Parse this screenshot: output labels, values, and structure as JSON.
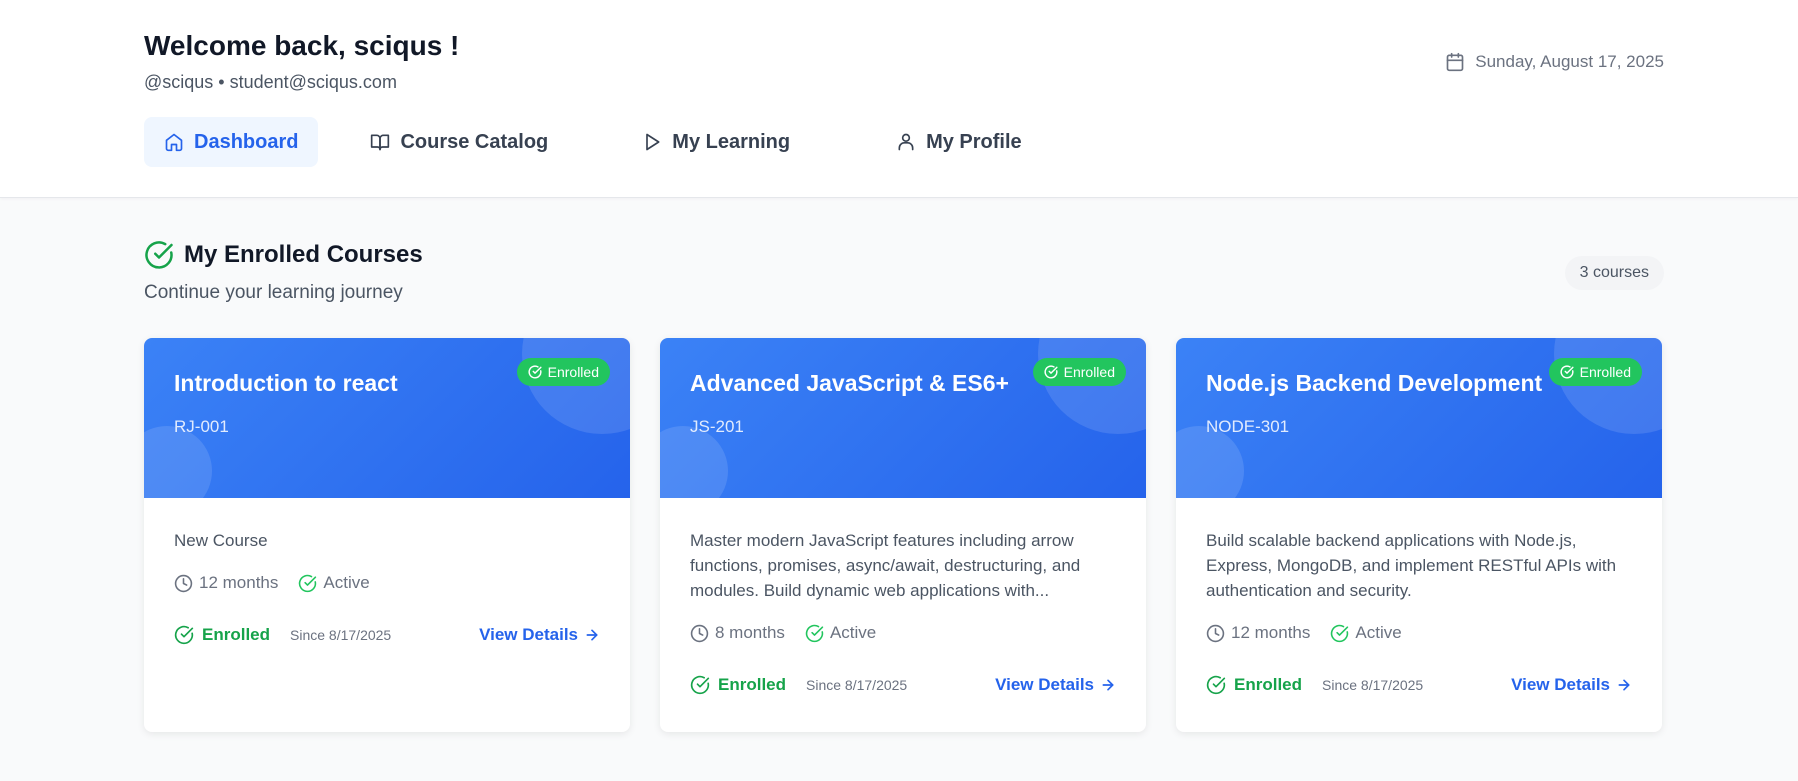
{
  "header": {
    "welcome": "Welcome back, sciqus !",
    "subline": "@sciqus • student@sciqus.com",
    "date": "Sunday, August 17, 2025"
  },
  "nav": {
    "dashboard": "Dashboard",
    "catalog": "Course Catalog",
    "learning": "My Learning",
    "profile": "My Profile"
  },
  "section": {
    "title": "My Enrolled Courses",
    "subtitle": "Continue your learning journey",
    "count": "3 courses"
  },
  "courses": [
    {
      "badge": "Enrolled",
      "title": "Introduction to react",
      "code": "RJ-001",
      "description": "New Course",
      "duration": "12 months",
      "status": "Active",
      "enrolled": "Enrolled",
      "since": "Since 8/17/2025",
      "view": "View Details"
    },
    {
      "badge": "Enrolled",
      "title": "Advanced JavaScript & ES6+",
      "code": "JS-201",
      "description": "Master modern JavaScript features including arrow functions, promises, async/await, destructuring, and modules. Build dynamic web applications with...",
      "duration": "8 months",
      "status": "Active",
      "enrolled": "Enrolled",
      "since": "Since 8/17/2025",
      "view": "View Details"
    },
    {
      "badge": "Enrolled",
      "title": "Node.js Backend Development",
      "code": "NODE-301",
      "description": "Build scalable backend applications with Node.js, Express, MongoDB, and implement RESTful APIs with authentication and security.",
      "duration": "12 months",
      "status": "Active",
      "enrolled": "Enrolled",
      "since": "Since 8/17/2025",
      "view": "View Details"
    }
  ],
  "colors": {
    "primary": "#2563eb",
    "success": "#16a34a",
    "badge": "#22c55e"
  }
}
